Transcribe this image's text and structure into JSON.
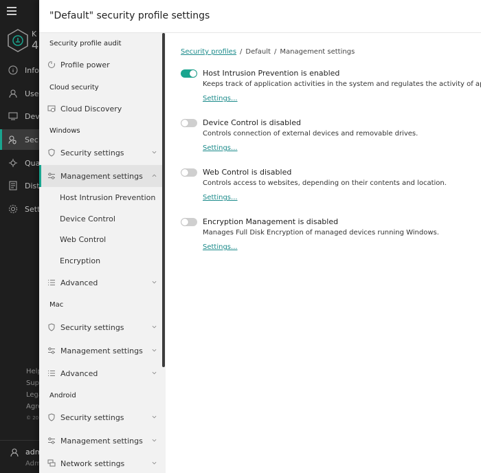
{
  "background_app": {
    "logo_text_top": "K",
    "logo_text_bottom": "4",
    "nav": [
      {
        "label": "Info",
        "icon": "info-icon"
      },
      {
        "label": "Use",
        "icon": "user-icon"
      },
      {
        "label": "Dev",
        "icon": "devices-icon"
      },
      {
        "label": "Sec",
        "icon": "security-icon",
        "active": true
      },
      {
        "label": "Qua",
        "icon": "quarantine-icon"
      },
      {
        "label": "Dist",
        "icon": "distribution-icon"
      },
      {
        "label": "Sett",
        "icon": "gear-icon"
      }
    ],
    "footer": [
      "Help",
      "Sup",
      "Lega",
      "Agre"
    ],
    "copyright": "© 20",
    "user_name": "adm",
    "user_role": "Adm"
  },
  "panel": {
    "title": "\"Default\" security profile settings"
  },
  "menu": {
    "sections": {
      "audit": "Security profile audit",
      "cloud": "Cloud security",
      "windows": "Windows",
      "mac": "Mac",
      "android": "Android"
    },
    "items": {
      "profile_power": "Profile power",
      "cloud_discovery": "Cloud Discovery",
      "win_security": "Security settings",
      "win_management": "Management settings",
      "win_sub_hip": "Host Intrusion Prevention",
      "win_sub_device": "Device Control",
      "win_sub_web": "Web Control",
      "win_sub_encryption": "Encryption",
      "win_advanced": "Advanced",
      "mac_security": "Security settings",
      "mac_management": "Management settings",
      "mac_advanced": "Advanced",
      "and_security": "Security settings",
      "and_management": "Management settings",
      "and_network": "Network settings"
    }
  },
  "breadcrumb": {
    "link": "Security profiles",
    "profile": "Default",
    "current": "Management settings"
  },
  "features": [
    {
      "title": "Host Intrusion Prevention is enabled",
      "description": "Keeps track of application activities in the system and regulates the activity of applicat",
      "link": "Settings...",
      "enabled": true
    },
    {
      "title": "Device Control is disabled",
      "description": "Controls connection of external devices and removable drives.",
      "link": "Settings...",
      "enabled": false
    },
    {
      "title": "Web Control is disabled",
      "description": "Controls access to websites, depending on their contents and location.",
      "link": "Settings...",
      "enabled": false
    },
    {
      "title": "Encryption Management is disabled",
      "description": "Manages Full Disk Encryption of managed devices running Windows.",
      "link": "Settings...",
      "enabled": false
    }
  ],
  "colors": {
    "accent": "#1aa58f",
    "link": "#1a8a8a",
    "sidebar_dark": "#1e1e1e",
    "menu_bg": "#f2f2f2"
  }
}
